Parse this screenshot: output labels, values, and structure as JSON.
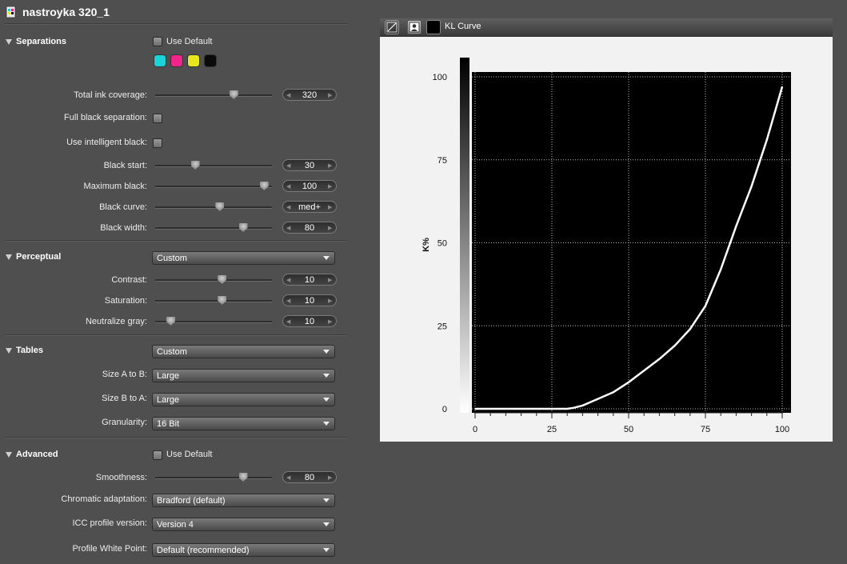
{
  "window": {
    "title": "nastroyka 320_1"
  },
  "sections": {
    "separations": {
      "title": "Separations",
      "use_default_label": "Use Default",
      "swatches": [
        "#19d3d8",
        "#f0258a",
        "#e8e61c",
        "#0a0a0a"
      ],
      "total_ink": {
        "label": "Total ink coverage:",
        "value": "320",
        "level": 0.67
      },
      "full_black": {
        "label": "Full black separation:"
      },
      "intelligent_black": {
        "label": "Use intelligent black:"
      },
      "black_start": {
        "label": "Black start:",
        "value": "30",
        "level": 0.34
      },
      "max_black": {
        "label": "Maximum black:",
        "value": "100",
        "level": 0.93
      },
      "black_curve": {
        "label": "Black curve:",
        "value": "med+",
        "level": 0.55
      },
      "black_width": {
        "label": "Black width:",
        "value": "80",
        "level": 0.75
      }
    },
    "perceptual": {
      "title": "Perceptual",
      "mode": "Custom",
      "contrast": {
        "label": "Contrast:",
        "value": "10",
        "level": 0.57
      },
      "saturation": {
        "label": "Saturation:",
        "value": "10",
        "level": 0.57
      },
      "neutralize": {
        "label": "Neutralize gray:",
        "value": "10",
        "level": 0.13
      }
    },
    "tables": {
      "title": "Tables",
      "mode": "Custom",
      "size_a_b": {
        "label": "Size A to B:",
        "value": "Large"
      },
      "size_b_a": {
        "label": "Size B to A:",
        "value": "Large"
      },
      "granularity": {
        "label": "Granularity:",
        "value": "16 Bit"
      }
    },
    "advanced": {
      "title": "Advanced",
      "use_default_label": "Use Default",
      "smoothness": {
        "label": "Smoothness:",
        "value": "80",
        "level": 0.75
      },
      "chromatic": {
        "label": "Chromatic adaptation:",
        "value": "Bradford (default)"
      },
      "icc_version": {
        "label": "ICC profile version:",
        "value": "Version 4"
      },
      "white_point": {
        "label": "Profile White Point:",
        "value": "Default (recommended)"
      }
    }
  },
  "chart_panel": {
    "title": "KL Curve",
    "tools": [
      "curve-tool-icon",
      "image-tool-icon",
      "black-swatch"
    ]
  },
  "chart_data": {
    "type": "line",
    "title": "",
    "xlabel": "",
    "ylabel": "K%",
    "xlim": [
      0,
      100
    ],
    "ylim": [
      0,
      100
    ],
    "x_ticks": [
      "0",
      "25",
      "50",
      "75",
      "100"
    ],
    "y_ticks": [
      "0",
      "25",
      "50",
      "75",
      "100"
    ],
    "grid": true,
    "series": [
      {
        "x": [
          0,
          10,
          20,
          30,
          32,
          35,
          40,
          45,
          50,
          55,
          60,
          65,
          70,
          75,
          80,
          85,
          90,
          95,
          100
        ],
        "y": [
          0,
          0,
          0,
          0,
          0.3,
          1,
          3,
          5,
          8,
          11.5,
          15,
          19,
          24,
          31,
          42,
          55,
          67,
          81,
          97
        ]
      }
    ]
  }
}
